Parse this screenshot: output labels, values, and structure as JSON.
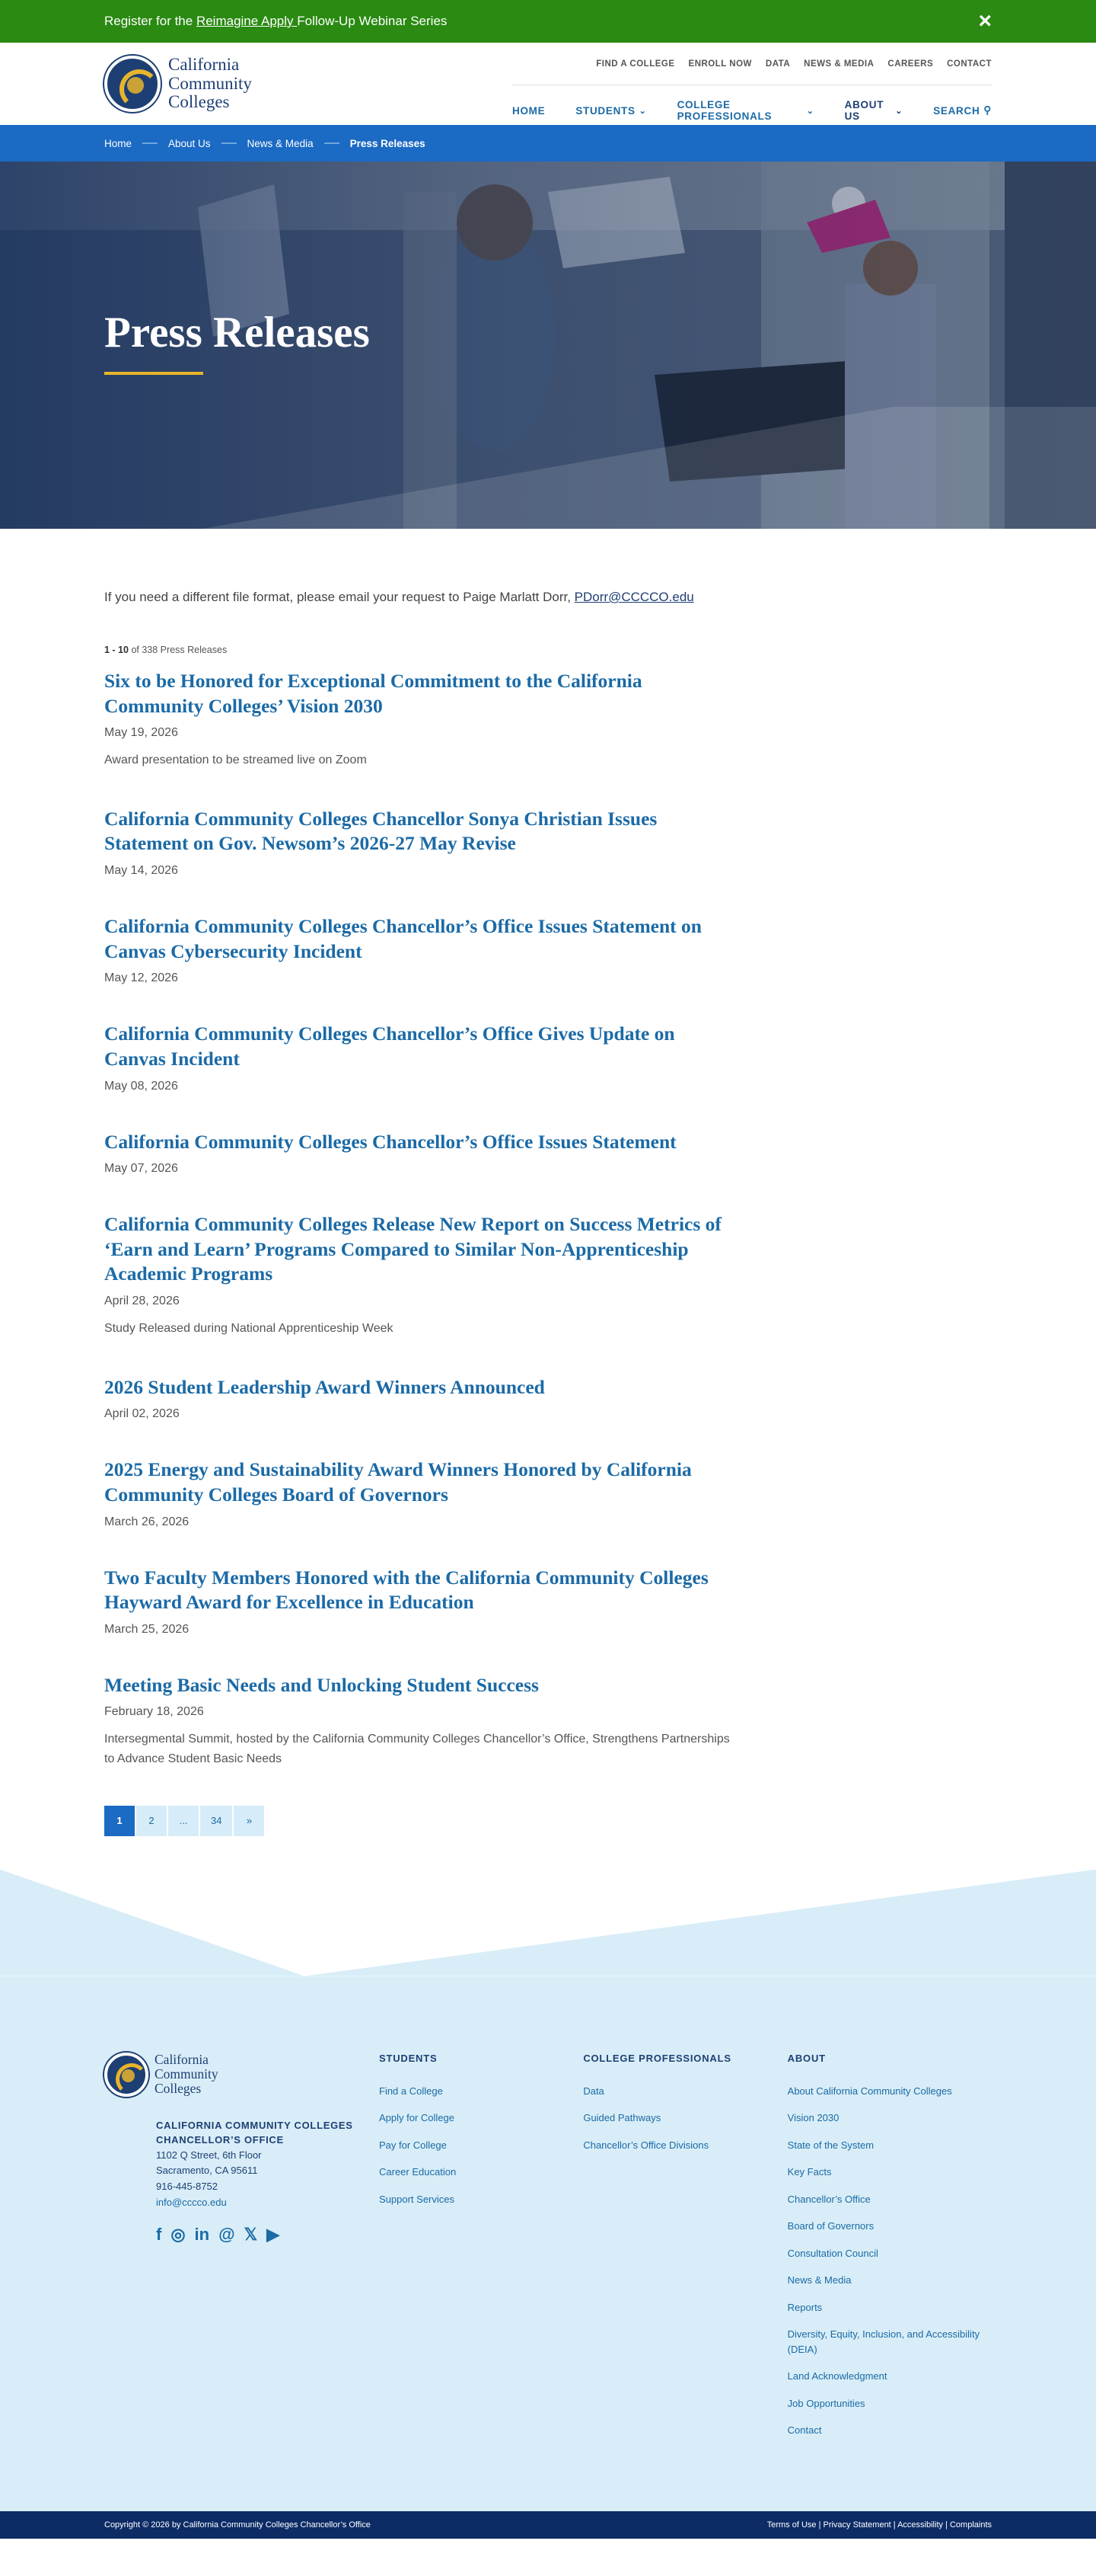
{
  "banner": {
    "text_before": "Register for the ",
    "link": "Reimagine Apply ",
    "text_after": "Follow-Up Webinar Series",
    "close_icon": "×"
  },
  "logo": {
    "line1": "California",
    "line2": "Community",
    "line3": "Colleges"
  },
  "util_nav": [
    "FIND A COLLEGE",
    "ENROLL NOW",
    "DATA",
    "NEWS & MEDIA",
    "CAREERS",
    "CONTACT"
  ],
  "main_nav": {
    "home": "HOME",
    "students": "STUDENTS",
    "professionals": "COLLEGE PROFESSIONALS",
    "about": "ABOUT US",
    "search": "SEARCH",
    "chevron": "⌄",
    "search_icon": "⚲"
  },
  "breadcrumb": [
    "Home",
    "About Us",
    "News & Media",
    "Press Releases"
  ],
  "hero": {
    "title": "Press Releases"
  },
  "intro": {
    "text": "If you need a different file format, please email your request to Paige Marlatt Dorr, ",
    "email": "PDorr@CCCCO.edu"
  },
  "count": {
    "range": "1 - 10",
    "rest": " of 338 Press Releases"
  },
  "releases": [
    {
      "title": "Six to be Honored for Exceptional Commitment to the California Community Colleges’ Vision 2030",
      "date": "May 19, 2026",
      "sub": "Award presentation to be streamed live on Zoom"
    },
    {
      "title": "California Community Colleges Chancellor Sonya Christian Issues Statement on Gov. Newsom’s 2026-27 May Revise",
      "date": "May 14, 2026",
      "sub": ""
    },
    {
      "title": "California Community Colleges Chancellor’s Office Issues Statement on Canvas Cybersecurity Incident",
      "date": "May 12, 2026",
      "sub": ""
    },
    {
      "title": "California Community Colleges Chancellor’s Office Gives Update on Canvas Incident",
      "date": "May 08, 2026",
      "sub": ""
    },
    {
      "title": "California Community Colleges Chancellor’s Office Issues Statement",
      "date": "May 07, 2026",
      "sub": ""
    },
    {
      "title": "California Community Colleges Release New Report on Success Metrics of ‘Earn and Learn’ Programs Compared to Similar Non-Apprenticeship Academic Programs",
      "date": "April 28, 2026",
      "sub": "Study Released during National Apprenticeship Week"
    },
    {
      "title": "2026 Student Leadership Award Winners Announced",
      "date": "April 02, 2026",
      "sub": ""
    },
    {
      "title": "2025 Energy and Sustainability Award Winners Honored by California Community Colleges Board of Governors",
      "date": "March 26, 2026",
      "sub": ""
    },
    {
      "title": "Two Faculty Members Honored with the California Community Colleges Hayward Award for Excellence in Education",
      "date": "March 25, 2026",
      "sub": ""
    },
    {
      "title": "Meeting Basic Needs and Unlocking Student Success",
      "date": "February 18, 2026",
      "sub": "Intersegmental Summit, hosted by the California Community Colleges Chancellor’s Office, Strengthens Partnerships to Advance Student Basic Needs"
    }
  ],
  "pager": {
    "p1": "1",
    "p2": "2",
    "ellipsis": "...",
    "last": "34",
    "next": "»"
  },
  "footer": {
    "org": "CALIFORNIA COMMUNITY COLLEGES CHANCELLOR’S OFFICE",
    "addr1": "1102 Q Street, 6th Floor",
    "addr2": "Sacramento, CA 95611",
    "phone": "916-445-8752",
    "email": "info@cccco.edu",
    "social": {
      "facebook": "f",
      "instagram": "◎",
      "linkedin": "in",
      "threads": "@",
      "x": "𝕏",
      "youtube": "▶"
    },
    "students_heading": "STUDENTS",
    "students": [
      "Find a College",
      "Apply for College",
      "Pay for College",
      "Career Education",
      "Support Services"
    ],
    "pros_heading": "COLLEGE PROFESSIONALS",
    "pros": [
      "Data",
      "Guided Pathways",
      "Chancellor’s Office Divisions"
    ],
    "about_heading": "ABOUT",
    "about": [
      "About California Community Colleges",
      "Vision 2030",
      "State of the System",
      "Key Facts",
      "Chancellor’s Office",
      "Board of Governors",
      "Consultation Council",
      "News & Media",
      "Reports",
      "Diversity, Equity, Inclusion, and Accessibility (DEIA)",
      "Land Acknowledgment",
      "Job Opportunities",
      "Contact"
    ]
  },
  "bottom": {
    "copyright": "Copyright © 2026 by California Community Colleges Chancellor’s Office",
    "links": "Terms of Use | Privacy Statement | Accessibility | Complaints"
  },
  "colors": {
    "banner_green": "#2a8a12",
    "brand_blue": "#1b6ac4",
    "navy": "#1e3f74",
    "gold": "#e7b52b",
    "footer_bg": "#d8edf7"
  }
}
